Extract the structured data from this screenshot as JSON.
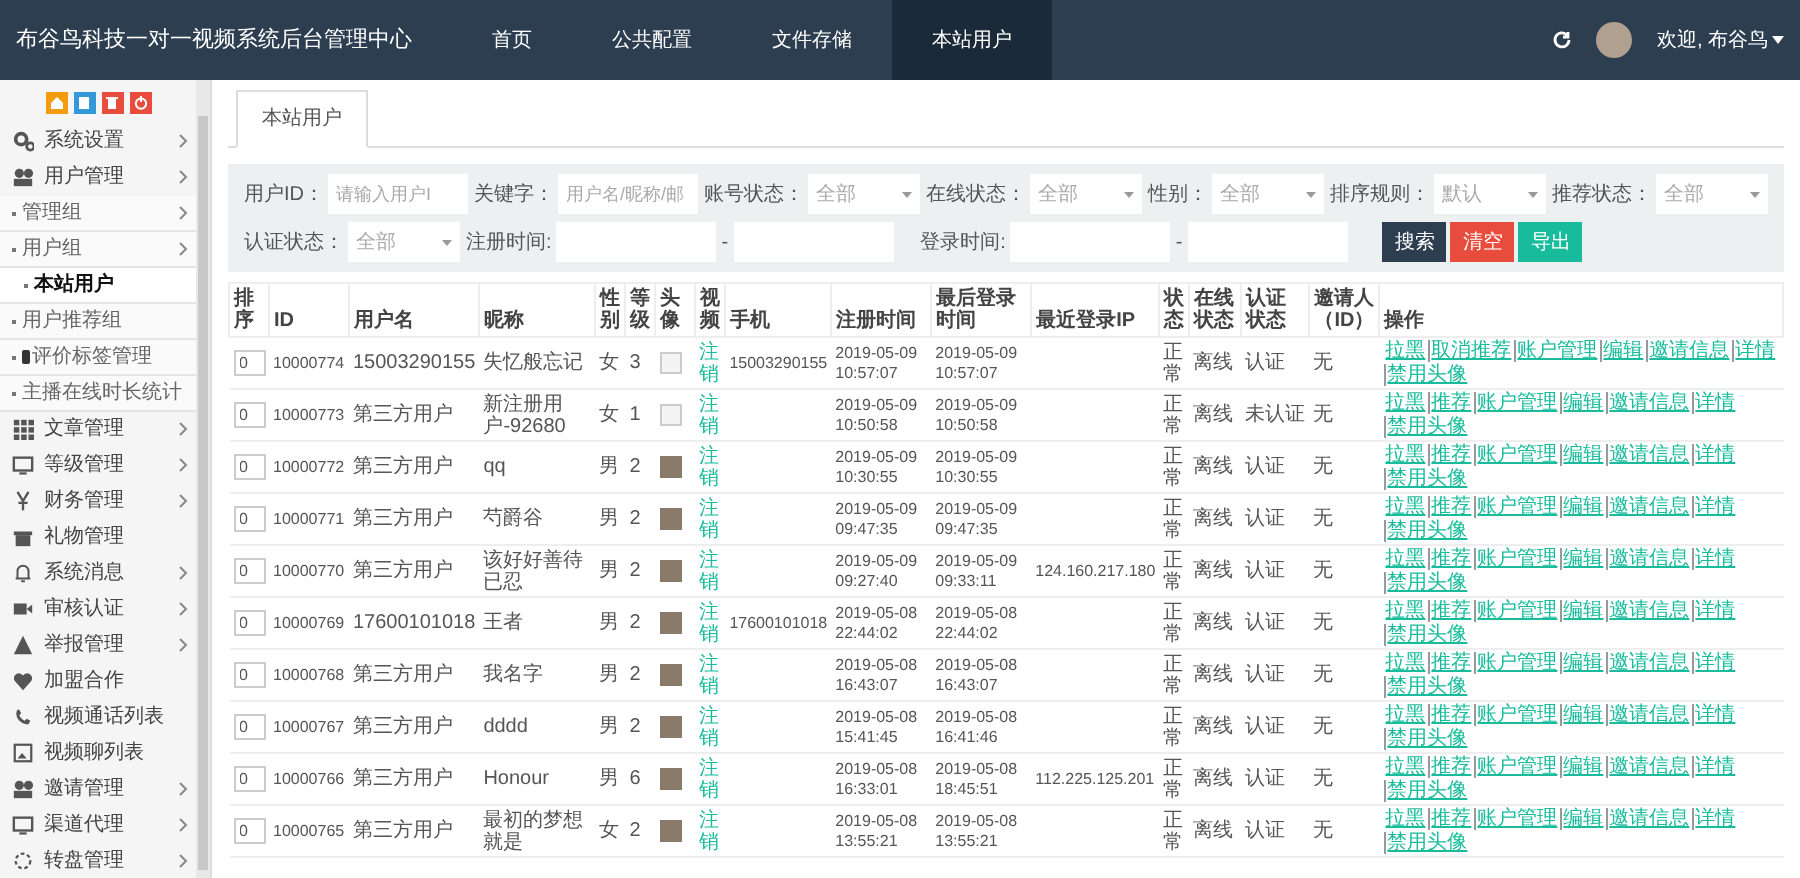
{
  "header": {
    "title": "布谷鸟科技一对一视频系统后台管理中心",
    "nav": [
      {
        "label": "首页",
        "selected": false
      },
      {
        "label": "公共配置",
        "selected": false
      },
      {
        "label": "文件存储",
        "selected": false
      },
      {
        "label": "本站用户",
        "selected": true
      }
    ],
    "user": "欢迎, 布谷鸟"
  },
  "sidebar": {
    "items": [
      {
        "label": "系统设置",
        "submenu": true,
        "selected": false
      },
      {
        "label": "用户管理",
        "submenu": true,
        "selected": false,
        "children": [
          {
            "label": "管理组",
            "submenu": true,
            "selected": false
          },
          {
            "label": "用户组",
            "submenu": true,
            "selected": false,
            "children": [
              {
                "label": "本站用户",
                "submenu": false,
                "selected": true
              }
            ]
          },
          {
            "label": "用户推荐组",
            "submenu": false,
            "selected": false
          },
          {
            "label": "评价标签管理",
            "submenu": false,
            "selected": false,
            "has_icon": true
          },
          {
            "label": "主播在线时长统计",
            "submenu": false,
            "selected": false
          }
        ]
      },
      {
        "label": "文章管理",
        "submenu": true,
        "selected": false
      },
      {
        "label": "等级管理",
        "submenu": true,
        "selected": false
      },
      {
        "label": "财务管理",
        "submenu": true,
        "selected": false
      },
      {
        "label": "礼物管理",
        "submenu": false,
        "selected": false
      },
      {
        "label": "系统消息",
        "submenu": true,
        "selected": false
      },
      {
        "label": "审核认证",
        "submenu": true,
        "selected": false
      },
      {
        "label": "举报管理",
        "submenu": true,
        "selected": false
      },
      {
        "label": "加盟合作",
        "submenu": false,
        "selected": false
      },
      {
        "label": "视频通话列表",
        "submenu": false,
        "selected": false
      },
      {
        "label": "视频聊列表",
        "submenu": false,
        "selected": false
      },
      {
        "label": "邀请管理",
        "submenu": true,
        "selected": false
      },
      {
        "label": "渠道代理",
        "submenu": true,
        "selected": false
      },
      {
        "label": "转盘管理",
        "submenu": true,
        "selected": false
      }
    ]
  },
  "tabs": [
    {
      "label": "本站用户",
      "selected": true
    }
  ],
  "filters": [
    {
      "kind": "input",
      "label": "用户ID：",
      "placeholder": "请输入用户I"
    },
    {
      "kind": "input",
      "label": "关键字：",
      "placeholder": "用户名/昵称/邮"
    },
    {
      "kind": "select",
      "label": "账号状态：",
      "value": "全部"
    },
    {
      "kind": "select",
      "label": "在线状态：",
      "value": "全部"
    },
    {
      "kind": "select",
      "label": "性别：",
      "value": "全部"
    },
    {
      "kind": "select",
      "label": "排序规则：",
      "value": "默认"
    },
    {
      "kind": "select",
      "label": "推荐状态：",
      "value": "全部"
    },
    {
      "kind": "select",
      "label": "认证状态：",
      "value": "全部"
    },
    {
      "kind": "range",
      "label": "注册时间:",
      "separator": "-"
    },
    {
      "kind": "range",
      "label": "登录时间:",
      "separator": "-"
    }
  ],
  "buttons": [
    {
      "label": "搜索",
      "kind": "primary"
    },
    {
      "label": "清空",
      "kind": "danger"
    },
    {
      "label": "导出",
      "kind": "success"
    }
  ],
  "table": {
    "columns": [
      "排序",
      "ID",
      "用户名",
      "昵称",
      "性别",
      "等级",
      "头像",
      "视频",
      "手机",
      "注册时间",
      "最后登录时间",
      "最近登录IP",
      "状态",
      "在线状态",
      "认证状态",
      "邀请人（ID）",
      "操作"
    ],
    "rows": [
      {
        "sort": "0",
        "id": "10000774",
        "username": "15003290155",
        "nickname": "失忆般忘记",
        "gender": "女",
        "level": "3",
        "avatar": {
          "kind": "broken"
        },
        "video": "注销",
        "phone": "15003290155",
        "registered": "2019-05-09 10:57:07",
        "last_login": "2019-05-09 10:57:07",
        "status": "正常",
        "online": "离线",
        "auth": "认证",
        "inviter": "无",
        "actions": [
          "拉黑",
          "取消推荐",
          "账户管理",
          "编辑",
          "邀请信息",
          "详情",
          "禁用头像"
        ]
      },
      {
        "sort": "0",
        "id": "10000773",
        "username": "第三方用户",
        "nickname": "新注册用户-92680",
        "gender": "女",
        "level": "1",
        "avatar": {
          "kind": "broken"
        },
        "video": "注销",
        "registered": "2019-05-09 10:50:58",
        "last_login": "2019-05-09 10:50:58",
        "status": "正常",
        "online": "离线",
        "auth": "未认证",
        "inviter": "无",
        "actions": [
          "拉黑",
          "推荐",
          "账户管理",
          "编辑",
          "邀请信息",
          "详情",
          "禁用头像"
        ]
      },
      {
        "sort": "0",
        "id": "10000772",
        "username": "第三方用户",
        "nickname": "qq",
        "gender": "男",
        "level": "2",
        "avatar": {
          "kind": "photo"
        },
        "video": "注销",
        "registered": "2019-05-09 10:30:55",
        "last_login": "2019-05-09 10:30:55",
        "status": "正常",
        "online": "离线",
        "auth": "认证",
        "inviter": "无",
        "actions": [
          "拉黑",
          "推荐",
          "账户管理",
          "编辑",
          "邀请信息",
          "详情",
          "禁用头像"
        ]
      },
      {
        "sort": "0",
        "id": "10000771",
        "username": "第三方用户",
        "nickname": "芍爵谷",
        "gender": "男",
        "level": "2",
        "avatar": {
          "kind": "photo"
        },
        "video": "注销",
        "registered": "2019-05-09 09:47:35",
        "last_login": "2019-05-09 09:47:35",
        "status": "正常",
        "online": "离线",
        "auth": "认证",
        "inviter": "无",
        "actions": [
          "拉黑",
          "推荐",
          "账户管理",
          "编辑",
          "邀请信息",
          "详情",
          "禁用头像"
        ]
      },
      {
        "sort": "0",
        "id": "10000770",
        "username": "第三方用户",
        "nickname": "该好好善待已忍",
        "gender": "男",
        "level": "2",
        "avatar": {
          "kind": "photo"
        },
        "video": "注销",
        "registered": "2019-05-09 09:27:40",
        "last_login": "2019-05-09 09:33:11",
        "ip": "124.160.217.180",
        "status": "正常",
        "online": "离线",
        "auth": "认证",
        "inviter": "无",
        "actions": [
          "拉黑",
          "推荐",
          "账户管理",
          "编辑",
          "邀请信息",
          "详情",
          "禁用头像"
        ]
      },
      {
        "sort": "0",
        "id": "10000769",
        "username": "17600101018",
        "nickname": "王者",
        "gender": "男",
        "level": "2",
        "avatar": {
          "kind": "photo"
        },
        "video": "注销",
        "phone": "17600101018",
        "registered": "2019-05-08 22:44:02",
        "last_login": "2019-05-08 22:44:02",
        "status": "正常",
        "online": "离线",
        "auth": "认证",
        "inviter": "无",
        "actions": [
          "拉黑",
          "推荐",
          "账户管理",
          "编辑",
          "邀请信息",
          "详情",
          "禁用头像"
        ]
      },
      {
        "sort": "0",
        "id": "10000768",
        "username": "第三方用户",
        "nickname": "我名字",
        "gender": "男",
        "level": "2",
        "avatar": {
          "kind": "photo"
        },
        "video": "注销",
        "registered": "2019-05-08 16:43:07",
        "last_login": "2019-05-08 16:43:07",
        "status": "正常",
        "online": "离线",
        "auth": "认证",
        "inviter": "无",
        "actions": [
          "拉黑",
          "推荐",
          "账户管理",
          "编辑",
          "邀请信息",
          "详情",
          "禁用头像"
        ]
      },
      {
        "sort": "0",
        "id": "10000767",
        "username": "第三方用户",
        "nickname": "dddd",
        "gender": "男",
        "level": "2",
        "avatar": {
          "kind": "photo"
        },
        "video": "注销",
        "registered": "2019-05-08 15:41:45",
        "last_login": "2019-05-08 16:41:46",
        "status": "正常",
        "online": "离线",
        "auth": "认证",
        "inviter": "无",
        "actions": [
          "拉黑",
          "推荐",
          "账户管理",
          "编辑",
          "邀请信息",
          "详情",
          "禁用头像"
        ]
      },
      {
        "sort": "0",
        "id": "10000766",
        "username": "第三方用户",
        "nickname": "Honour",
        "gender": "男",
        "level": "6",
        "avatar": {
          "kind": "photo"
        },
        "video": "注销",
        "registered": "2019-05-08 16:33:01",
        "last_login": "2019-05-08 18:45:51",
        "ip": "112.225.125.201",
        "status": "正常",
        "online": "离线",
        "auth": "认证",
        "inviter": "无",
        "actions": [
          "拉黑",
          "推荐",
          "账户管理",
          "编辑",
          "邀请信息",
          "详情",
          "禁用头像"
        ]
      },
      {
        "sort": "0",
        "id": "10000765",
        "username": "第三方用户",
        "nickname": "最初的梦想就是",
        "gender": "女",
        "level": "2",
        "avatar": {
          "kind": "photo"
        },
        "video": "注销",
        "registered": "2019-05-08 13:55:21",
        "last_login": "2019-05-08 13:55:21",
        "status": "正常",
        "online": "离线",
        "auth": "认证",
        "inviter": "无",
        "actions": [
          "拉黑",
          "推荐",
          "账户管理",
          "编辑",
          "邀请信息",
          "详情",
          "禁用头像"
        ]
      }
    ]
  }
}
